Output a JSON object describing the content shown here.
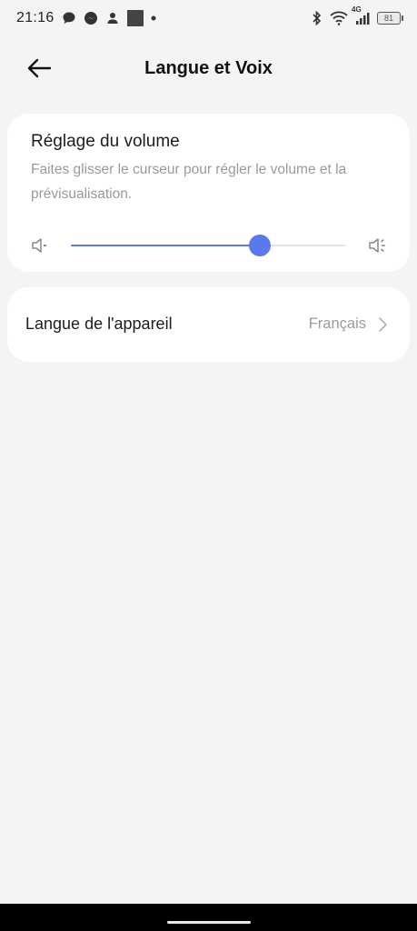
{
  "status_bar": {
    "time": "21:16",
    "network": "4G",
    "battery": "81",
    "notification_icons": [
      "chat-bubble-icon",
      "messenger-icon",
      "person-icon",
      "square-app-icon",
      "dot-icon"
    ],
    "system_icons": [
      "bluetooth-icon",
      "wifi-icon",
      "signal-icon",
      "battery-icon"
    ]
  },
  "header": {
    "title": "Langue et Voix"
  },
  "volume": {
    "title": "Réglage du volume",
    "description": "Faites glisser le curseur pour régler le volume et la prévisualisation.",
    "level_percent": 69,
    "accent_color": "#5b78ec"
  },
  "language": {
    "label": "Langue de l'appareil",
    "value": "Français"
  },
  "colors": {
    "background": "#f4f4f4",
    "card": "#ffffff",
    "secondary_text": "#9a9a9a"
  }
}
